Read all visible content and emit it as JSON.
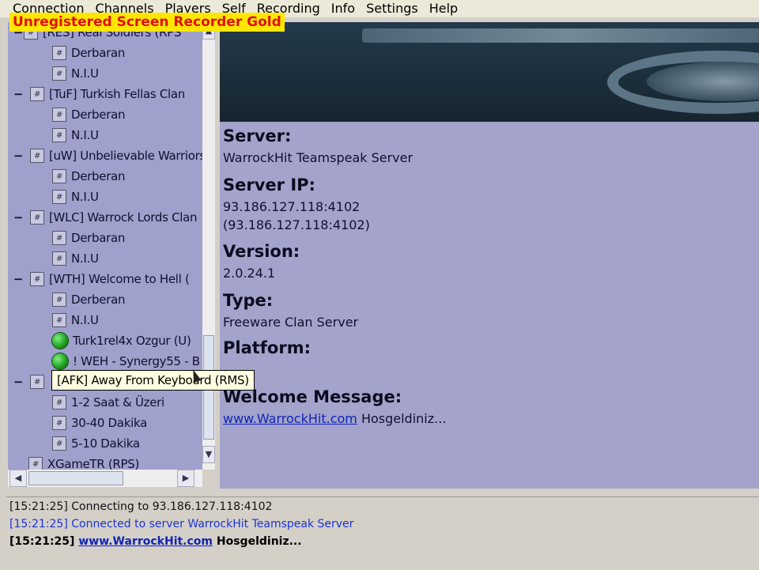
{
  "menu": [
    "Connection",
    "Channels",
    "Players",
    "Self",
    "Recording",
    "Info",
    "Settings",
    "Help"
  ],
  "watermark": "Unregistered Screen Recorder Gold",
  "tree": {
    "top_clip": "[RES] Real Soldiers   (RPS",
    "rows": [
      {
        "type": "sub",
        "label": "Derbaran"
      },
      {
        "type": "sub",
        "label": "N.I.U"
      },
      {
        "type": "channel",
        "label": "[TuF] Turkish Fellas Clan"
      },
      {
        "type": "sub",
        "label": "Derberan"
      },
      {
        "type": "sub",
        "label": "N.I.U"
      },
      {
        "type": "channel",
        "label": "[uW] Unbelievable Warriors"
      },
      {
        "type": "sub",
        "label": "Derberan"
      },
      {
        "type": "sub",
        "label": "N.I.U"
      },
      {
        "type": "channel",
        "label": "[WLC] Warrock Lords Clan"
      },
      {
        "type": "sub",
        "label": "Derbaran"
      },
      {
        "type": "sub",
        "label": "N.I.U"
      },
      {
        "type": "channel",
        "label": "[WTH] Welcome to Hell    ("
      },
      {
        "type": "sub",
        "label": "Derberan"
      },
      {
        "type": "sub",
        "label": "N.I.U"
      },
      {
        "type": "player",
        "label": "Turk1rel4x Ozgur  (U)"
      },
      {
        "type": "player",
        "label": "! WEH - Synergy55 - B"
      },
      {
        "type": "channel",
        "label": ""
      },
      {
        "type": "sub",
        "label": "1-2 Saat & Üzeri"
      },
      {
        "type": "sub",
        "label": "30-40 Dakika"
      },
      {
        "type": "sub",
        "label": "5-10  Dakika"
      },
      {
        "type": "channel_clip",
        "label": "XGameTR    (RPS)"
      }
    ],
    "tooltip": "[AFK] Away From Keyboard   (RMS)"
  },
  "server_info": {
    "server_label": "Server:",
    "server_value": "WarrockHit Teamspeak Server",
    "ip_label": "Server IP:",
    "ip_value_1": "93.186.127.118:4102",
    "ip_value_2": "(93.186.127.118:4102)",
    "version_label": "Version:",
    "version_value": "2.0.24.1",
    "type_label": "Type:",
    "type_value": "Freeware Clan Server",
    "platform_label": "Platform:",
    "welcome_label": "Welcome Message:",
    "welcome_link": "www.WarrockHit.com",
    "welcome_text": "Hosgeldiniz..."
  },
  "log": [
    {
      "time": "[15:21:25]",
      "text": "Connecting to 93.186.127.118:4102"
    },
    {
      "time": "[15:21:25]",
      "text": "Connected to server WarrockHit Teamspeak Server"
    },
    {
      "time": "[15:21:25]",
      "link": "www.WarrockHit.com",
      "text": "Hosgeldiniz..."
    }
  ],
  "colors": {
    "tree_bg": "#a0a0cc",
    "info_bg": "#a3a3cc",
    "player_online": "#1b9a1b",
    "link": "#0f24b4",
    "log_blue": "#1a32d8",
    "watermark_bg": "#ffe600",
    "watermark_text": "#e01010"
  }
}
